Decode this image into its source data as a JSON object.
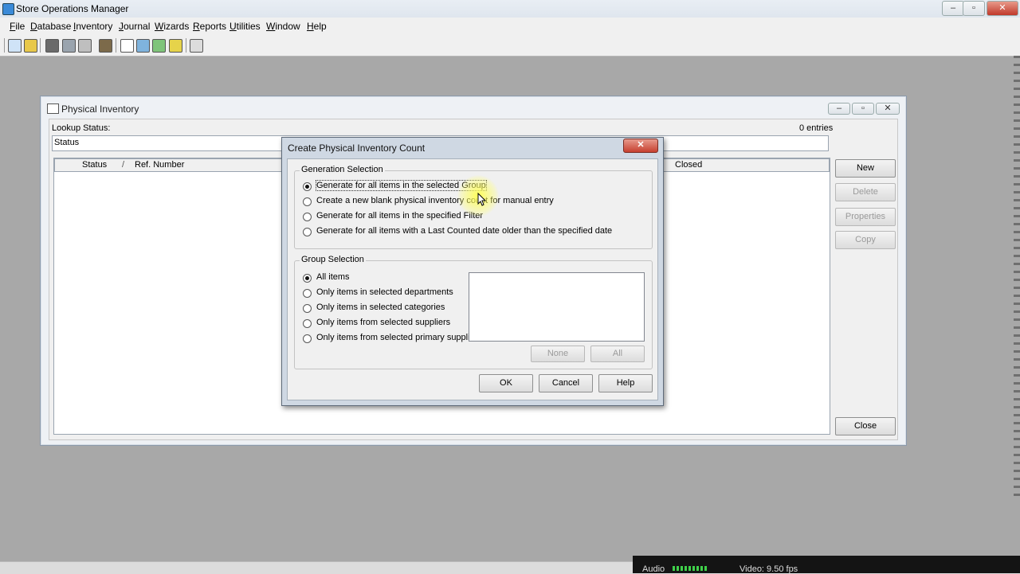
{
  "app": {
    "title": "Store Operations Manager",
    "window_controls": [
      "–",
      "▫",
      "✕"
    ]
  },
  "menu": {
    "items": [
      "File",
      "Database",
      "Inventory",
      "Journal",
      "Wizards",
      "Reports",
      "Utilities",
      "Window",
      "Help"
    ]
  },
  "toolbar": {
    "icons": [
      "edit-icon",
      "lock-icon",
      "heart-check-icon",
      "database-icon",
      "tools-icon",
      "box-icon",
      "document-icon",
      "export-icon",
      "import-icon",
      "pencil-icon",
      "report-icon"
    ]
  },
  "physical_inventory": {
    "title": "Physical Inventory",
    "lookup_label": "Lookup Status:",
    "lookup_value": "Status",
    "entries": "0 entries",
    "columns": {
      "status": "Status",
      "ref": "Ref. Number",
      "closed": "Closed"
    },
    "buttons": {
      "new": "New",
      "delete": "Delete",
      "properties": "Properties",
      "copy": "Copy",
      "close": "Close"
    }
  },
  "dialog": {
    "title": "Create Physical Inventory Count",
    "close": "✕",
    "generation": {
      "legend": "Generation Selection",
      "options": [
        "Generate for all items in the selected Group",
        "Create a new blank physical inventory count for manual entry",
        "Generate for all items in the specified Filter",
        "Generate for all items with a Last Counted date older than the specified date"
      ],
      "selected": 0
    },
    "group": {
      "legend": "Group Selection",
      "options": [
        "All items",
        "Only items in selected departments",
        "Only items in selected categories",
        "Only items from selected suppliers",
        "Only items from selected primary suppliers"
      ],
      "selected": 0,
      "none_button": "None",
      "all_button": "All"
    },
    "buttons": {
      "ok": "OK",
      "cancel": "Cancel",
      "help": "Help"
    }
  },
  "recorder": {
    "audio": "Audio",
    "video": "Video: 9.50 fps"
  }
}
